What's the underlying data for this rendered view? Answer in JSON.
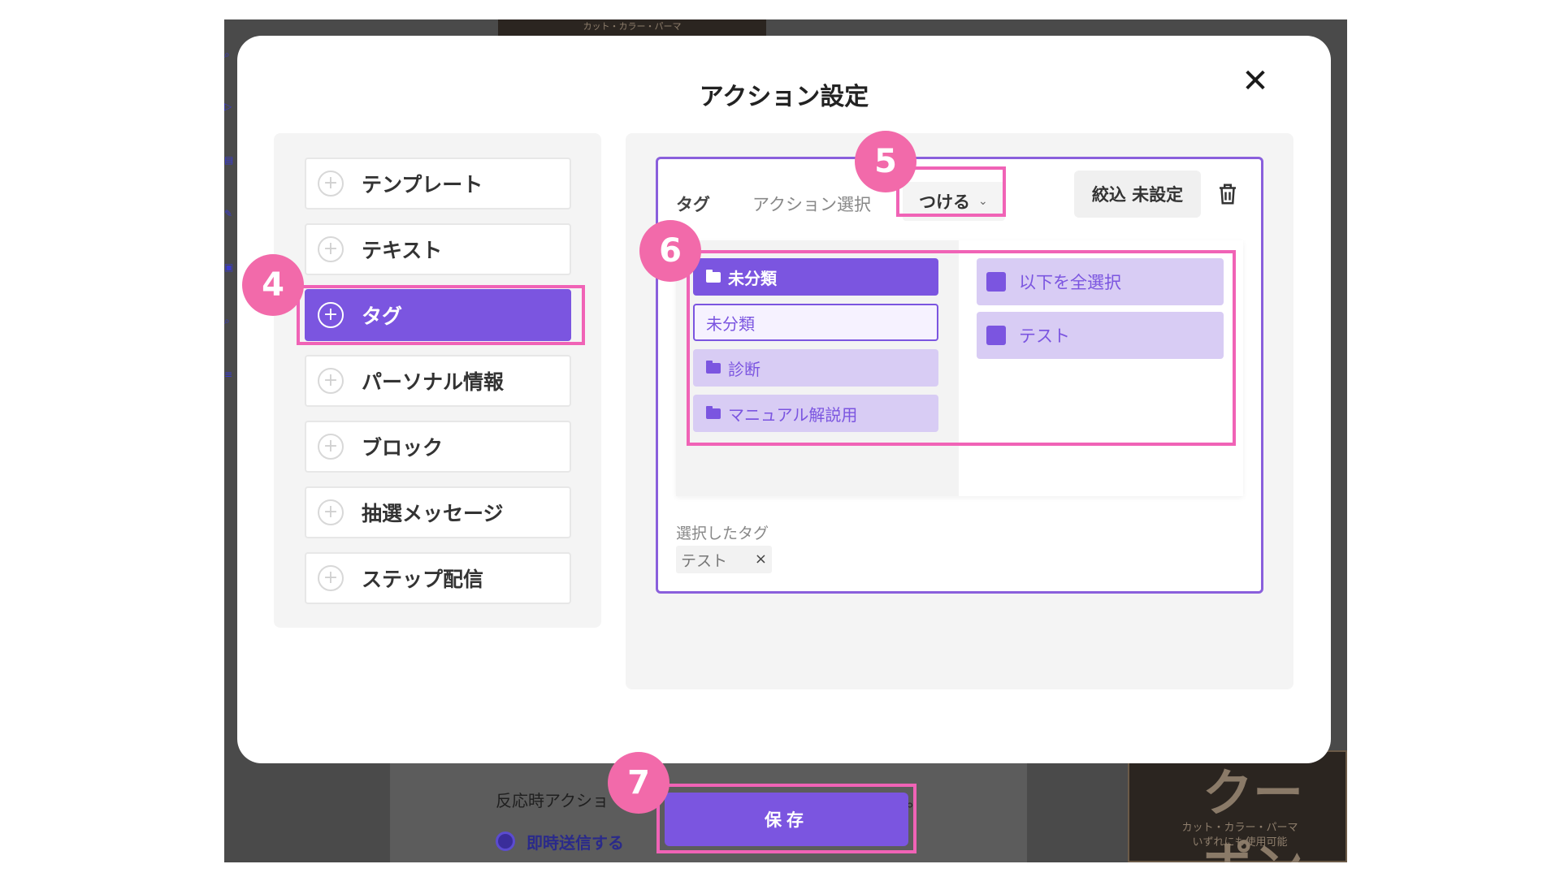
{
  "backdrop": {
    "top_card_text": "カット・カラー・パーマ",
    "reaction_text": "反応時アクショ",
    "reaction_suffix": "。",
    "radio_label": "即時送信する",
    "coupon_big": "クーポン",
    "coupon_small_1": "カット・カラー・パーマ",
    "coupon_small_2": "いずれにも使用可能"
  },
  "modal": {
    "title": "アクション設定",
    "close_icon": "close-icon"
  },
  "menu": {
    "items": [
      {
        "label": "テンプレート",
        "active": false
      },
      {
        "label": "テキスト",
        "active": false
      },
      {
        "label": "タグ",
        "active": true
      },
      {
        "label": "パーソナル情報",
        "active": false
      },
      {
        "label": "ブロック",
        "active": false
      },
      {
        "label": "抽選メッセージ",
        "active": false
      },
      {
        "label": "ステップ配信",
        "active": false
      }
    ]
  },
  "tag_card": {
    "label": "タグ",
    "action_label": "アクション選択",
    "action_value": "つける",
    "filter_label": "絞込 未設定",
    "trash_icon": "trash-icon"
  },
  "categories": [
    {
      "label": "未分類",
      "state": "active"
    },
    {
      "label": "未分類",
      "state": "outlined"
    },
    {
      "label": "診断",
      "state": "light"
    },
    {
      "label": "マニュアル解説用",
      "state": "light"
    }
  ],
  "tags": [
    {
      "label": "以下を全選択"
    },
    {
      "label": "テスト"
    }
  ],
  "selected": {
    "label": "選択したタグ",
    "chip": "テスト",
    "chip_remove": "×"
  },
  "save_label": "保存",
  "annotations": {
    "b4": "4",
    "b5": "5",
    "b6": "6",
    "b7": "7",
    "color": "#f063b6"
  },
  "colors": {
    "accent": "#7b55e0",
    "accent_light": "#d8ccf4",
    "highlight": "#f063b6"
  }
}
